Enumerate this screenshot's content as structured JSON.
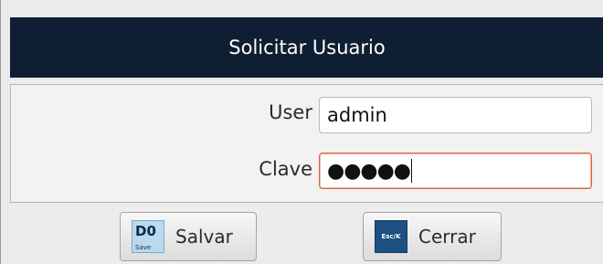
{
  "dialog": {
    "title": "Solicitar Usuario"
  },
  "form": {
    "user_label": "User",
    "user_value": "admin",
    "clave_label": "Clave",
    "clave_value_masked": "●●●●●"
  },
  "buttons": {
    "save": {
      "icon_main": "D0",
      "icon_sub": "Save",
      "label": "Salvar"
    },
    "close": {
      "icon_text": "Esc/K",
      "label": "Cerrar"
    }
  },
  "colors": {
    "titlebar_bg": "#0f1f33",
    "focus_border": "#d9663a",
    "save_icon_bg": "#b9d9ee",
    "close_icon_bg": "#1d4f82"
  }
}
